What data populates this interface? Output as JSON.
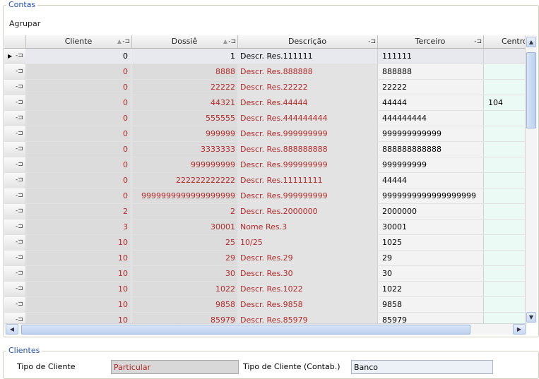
{
  "contas": {
    "legend": "Contas",
    "agrupar": "Agrupar",
    "columns": {
      "cliente": "Cliente",
      "dossie": "Dossiê",
      "descricao": "Descrição",
      "terceiro": "Terceiro",
      "centro": "Centro"
    },
    "rows": [
      {
        "cliente": "0",
        "dossie": "1",
        "descricao": "Descr. Res.111111",
        "terceiro": "111111",
        "centro": ""
      },
      {
        "cliente": "0",
        "dossie": "8888",
        "descricao": "Descr. Res.888888",
        "terceiro": "888888",
        "centro": ""
      },
      {
        "cliente": "0",
        "dossie": "22222",
        "descricao": "Descr. Res.22222",
        "terceiro": "22222",
        "centro": ""
      },
      {
        "cliente": "0",
        "dossie": "44321",
        "descricao": "Descr. Res.44444",
        "terceiro": "44444",
        "centro": "104"
      },
      {
        "cliente": "0",
        "dossie": "555555",
        "descricao": "Descr. Res.444444444",
        "terceiro": "444444444",
        "centro": ""
      },
      {
        "cliente": "0",
        "dossie": "999999",
        "descricao": "Descr. Res.999999999",
        "terceiro": "999999999999",
        "centro": ""
      },
      {
        "cliente": "0",
        "dossie": "3333333",
        "descricao": "Descr. Res.888888888",
        "terceiro": "888888888888",
        "centro": ""
      },
      {
        "cliente": "0",
        "dossie": "999999999",
        "descricao": "Descr. Res.999999999",
        "terceiro": "999999999",
        "centro": ""
      },
      {
        "cliente": "0",
        "dossie": "222222222222",
        "descricao": "Descr. Res.11111111",
        "terceiro": "44444",
        "centro": ""
      },
      {
        "cliente": "0",
        "dossie": "9999999999999999999",
        "descricao": "Descr. Res.999999999",
        "terceiro": "9999999999999999999",
        "centro": ""
      },
      {
        "cliente": "2",
        "dossie": "2",
        "descricao": "Descr. Res.2000000",
        "terceiro": "2000000",
        "centro": ""
      },
      {
        "cliente": "3",
        "dossie": "30001",
        "descricao": "Nome Res.3",
        "terceiro": "30001",
        "centro": ""
      },
      {
        "cliente": "10",
        "dossie": "25",
        "descricao": "10/25",
        "terceiro": "1025",
        "centro": ""
      },
      {
        "cliente": "10",
        "dossie": "29",
        "descricao": "Descr. Res.29",
        "terceiro": "29",
        "centro": ""
      },
      {
        "cliente": "10",
        "dossie": "30",
        "descricao": "Descr. Res.30",
        "terceiro": "30",
        "centro": ""
      },
      {
        "cliente": "10",
        "dossie": "1022",
        "descricao": "Descr. Res.1022",
        "terceiro": "1022",
        "centro": ""
      },
      {
        "cliente": "10",
        "dossie": "9858",
        "descricao": "Descr. Res.9858",
        "terceiro": "9858",
        "centro": ""
      },
      {
        "cliente": "10",
        "dossie": "85979",
        "descricao": "Descr. Res.85979",
        "terceiro": "85979",
        "centro": ""
      }
    ]
  },
  "clientes": {
    "legend": "Clientes",
    "tipo_label": "Tipo de Cliente",
    "tipo_value": "Particular",
    "tipo_contab_label": "Tipo de Cliente (Contab.)",
    "tipo_contab_value": "Banco"
  },
  "colors": {
    "legend": "#1f4fb4",
    "value_red": "#b22a2a",
    "grid_grey": "#dcdcdc",
    "centro_tint": "#ecfaf6"
  }
}
